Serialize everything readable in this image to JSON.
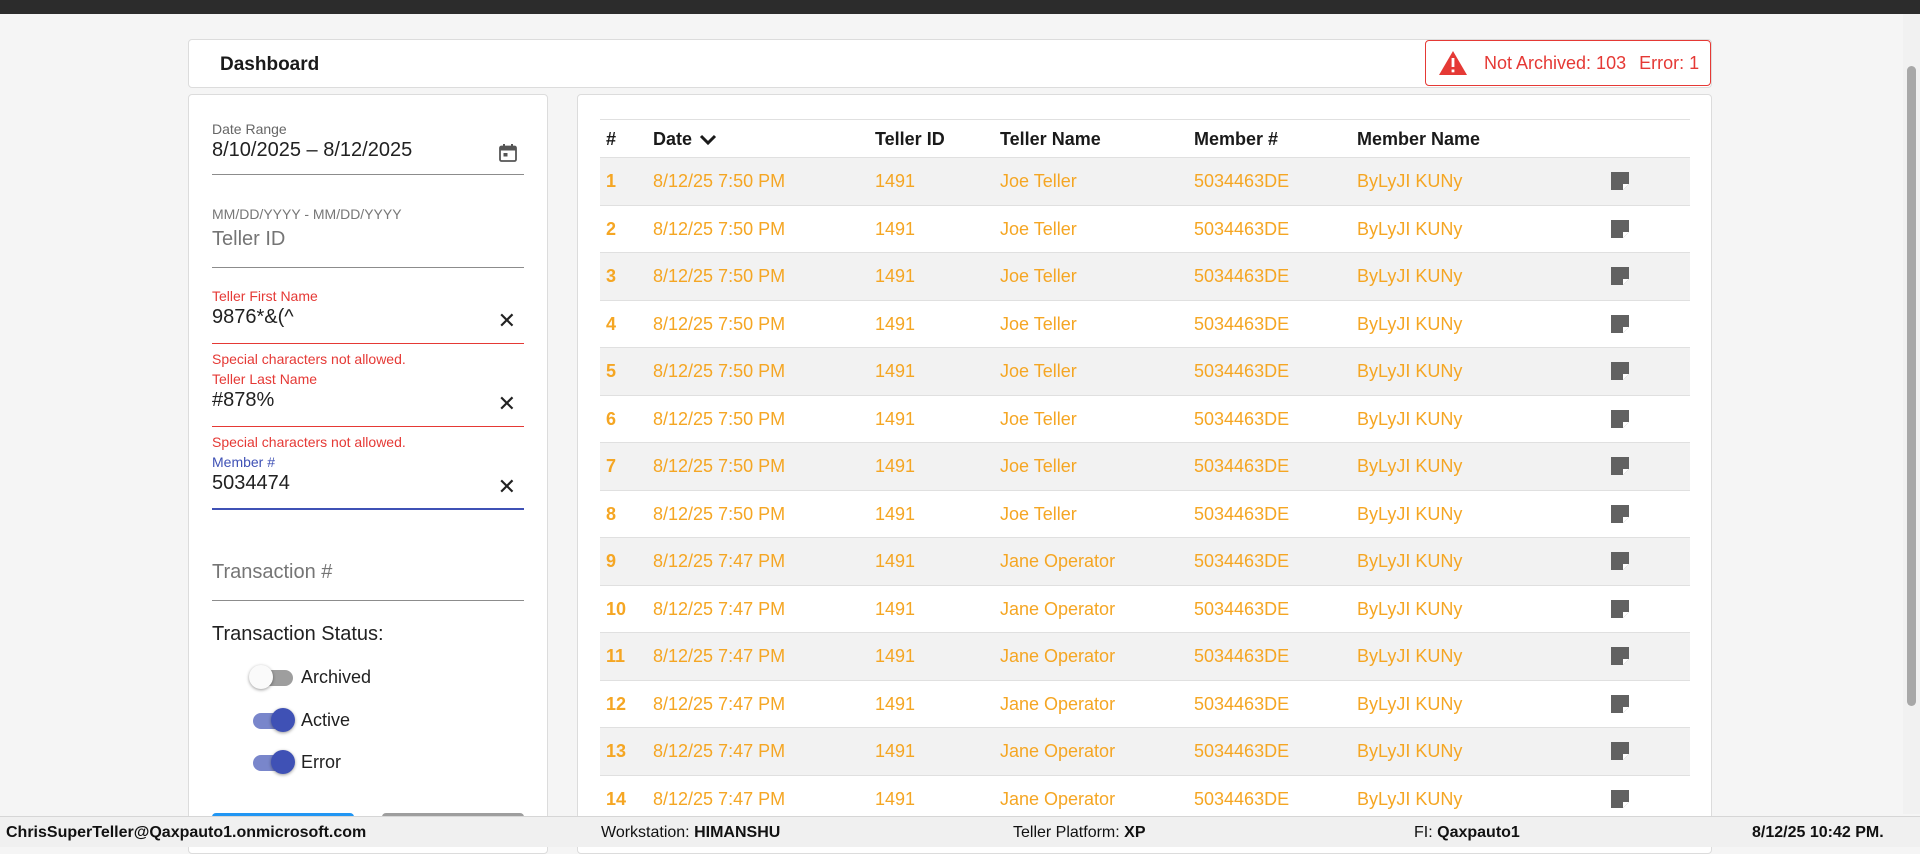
{
  "header": {
    "title": "Dashboard",
    "alert": {
      "not_archived": "Not Archived: 103",
      "error": "Error: 1",
      "color": "#e53935"
    }
  },
  "filters": {
    "date_range": {
      "label": "Date Range",
      "value": "8/10/2025 – 8/12/2025",
      "hint": "MM/DD/YYYY - MM/DD/YYYY"
    },
    "teller_id": {
      "placeholder": "Teller ID"
    },
    "teller_first_name": {
      "label": "Teller First Name",
      "value": "9876*&(^",
      "error": "Special characters not allowed."
    },
    "teller_last_name": {
      "label": "Teller Last Name",
      "value": "#878%",
      "error": "Special characters not allowed."
    },
    "member_number": {
      "label": "Member #",
      "value": "5034474"
    },
    "transaction_number": {
      "placeholder": "Transaction #"
    },
    "status": {
      "title": "Transaction Status:",
      "toggles": [
        {
          "label": "Archived",
          "on": false
        },
        {
          "label": "Active",
          "on": true
        },
        {
          "label": "Error",
          "on": true
        }
      ]
    },
    "clear_symbol": "✕"
  },
  "table": {
    "headers": {
      "num": "#",
      "date": "Date",
      "teller_id": "Teller ID",
      "teller_name": "Teller Name",
      "member_num": "Member #",
      "member_name": "Member Name"
    },
    "row_color": "#f5a623",
    "rows": [
      {
        "num": "1",
        "date": "8/12/25 7:50 PM",
        "teller_id": "1491",
        "teller_name": "Joe Teller",
        "member_num": "5034463DE",
        "member_name": "ByLyJI KUNy"
      },
      {
        "num": "2",
        "date": "8/12/25 7:50 PM",
        "teller_id": "1491",
        "teller_name": "Joe Teller",
        "member_num": "5034463DE",
        "member_name": "ByLyJI KUNy"
      },
      {
        "num": "3",
        "date": "8/12/25 7:50 PM",
        "teller_id": "1491",
        "teller_name": "Joe Teller",
        "member_num": "5034463DE",
        "member_name": "ByLyJI KUNy"
      },
      {
        "num": "4",
        "date": "8/12/25 7:50 PM",
        "teller_id": "1491",
        "teller_name": "Joe Teller",
        "member_num": "5034463DE",
        "member_name": "ByLyJI KUNy"
      },
      {
        "num": "5",
        "date": "8/12/25 7:50 PM",
        "teller_id": "1491",
        "teller_name": "Joe Teller",
        "member_num": "5034463DE",
        "member_name": "ByLyJI KUNy"
      },
      {
        "num": "6",
        "date": "8/12/25 7:50 PM",
        "teller_id": "1491",
        "teller_name": "Joe Teller",
        "member_num": "5034463DE",
        "member_name": "ByLyJI KUNy"
      },
      {
        "num": "7",
        "date": "8/12/25 7:50 PM",
        "teller_id": "1491",
        "teller_name": "Joe Teller",
        "member_num": "5034463DE",
        "member_name": "ByLyJI KUNy"
      },
      {
        "num": "8",
        "date": "8/12/25 7:50 PM",
        "teller_id": "1491",
        "teller_name": "Joe Teller",
        "member_num": "5034463DE",
        "member_name": "ByLyJI KUNy"
      },
      {
        "num": "9",
        "date": "8/12/25 7:47 PM",
        "teller_id": "1491",
        "teller_name": "Jane Operator",
        "member_num": "5034463DE",
        "member_name": "ByLyJI KUNy"
      },
      {
        "num": "10",
        "date": "8/12/25 7:47 PM",
        "teller_id": "1491",
        "teller_name": "Jane Operator",
        "member_num": "5034463DE",
        "member_name": "ByLyJI KUNy"
      },
      {
        "num": "11",
        "date": "8/12/25 7:47 PM",
        "teller_id": "1491",
        "teller_name": "Jane Operator",
        "member_num": "5034463DE",
        "member_name": "ByLyJI KUNy"
      },
      {
        "num": "12",
        "date": "8/12/25 7:47 PM",
        "teller_id": "1491",
        "teller_name": "Jane Operator",
        "member_num": "5034463DE",
        "member_name": "ByLyJI KUNy"
      },
      {
        "num": "13",
        "date": "8/12/25 7:47 PM",
        "teller_id": "1491",
        "teller_name": "Jane Operator",
        "member_num": "5034463DE",
        "member_name": "ByLyJI KUNy"
      },
      {
        "num": "14",
        "date": "8/12/25 7:47 PM",
        "teller_id": "1491",
        "teller_name": "Jane Operator",
        "member_num": "5034463DE",
        "member_name": "ByLyJI KUNy"
      }
    ]
  },
  "footer": {
    "user": "ChrisSuperTeller@Qaxpauto1.onmicrosoft.com",
    "workstation_label": "Workstation:",
    "workstation": "HIMANSHU",
    "platform_label": "Teller Platform:",
    "platform": "XP",
    "fi_label": "FI:",
    "fi": "Qaxpauto1",
    "datetime": "8/12/25 10:42 PM."
  }
}
